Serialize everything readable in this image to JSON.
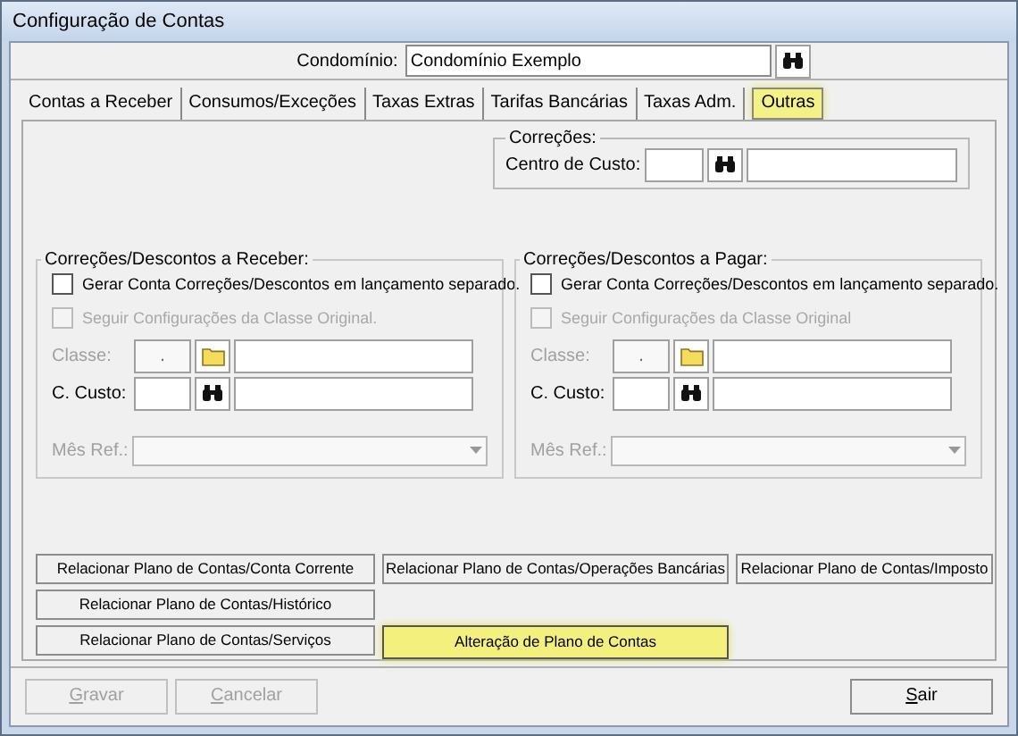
{
  "window": {
    "title": "Configuração de Contas"
  },
  "condominio": {
    "label": "Condomínio:",
    "value": "Condomínio Exemplo"
  },
  "tabs": [
    {
      "label": "Contas a Receber",
      "selected": false
    },
    {
      "label": "Consumos/Exceções",
      "selected": false
    },
    {
      "label": "Taxas Extras",
      "selected": false
    },
    {
      "label": "Tarifas Bancárias",
      "selected": false
    },
    {
      "label": "Taxas Adm.",
      "selected": false
    },
    {
      "label": "Outras",
      "selected": true
    }
  ],
  "correcoes": {
    "title": "Correções:",
    "label": "Centro de Custo:"
  },
  "groups": [
    {
      "title": "Correções/Descontos a Receber:",
      "checkboxes": [
        {
          "label": "Gerar Conta Correções/Descontos em lançamento separado.",
          "checked": false,
          "disabled": false
        },
        {
          "label": "Seguir Configurações da Classe Original.",
          "checked": false,
          "disabled": true
        }
      ],
      "classe": {
        "label": "Classe:",
        "value": ".",
        "disabled": true
      },
      "custo": {
        "label": "C. Custo:",
        "disabled": false
      },
      "mes": {
        "label": "Mês Ref.:",
        "disabled": true
      }
    },
    {
      "title": "Correções/Descontos a Pagar:",
      "checkboxes": [
        {
          "label": "Gerar Conta Correções/Descontos em lançamento separado.",
          "checked": false,
          "disabled": false
        },
        {
          "label": "Seguir Configurações da Classe Original",
          "checked": false,
          "disabled": true
        }
      ],
      "classe": {
        "label": "Classe:",
        "value": ".",
        "disabled": true
      },
      "custo": {
        "label": "C. Custo:",
        "disabled": false
      },
      "mes": {
        "label": "Mês Ref.:",
        "disabled": true
      }
    }
  ],
  "link_buttons": [
    {
      "label": "Relacionar Plano de Contas/Conta Corrente",
      "highlighted": false
    },
    {
      "label": "Relacionar Plano de Contas/Operações Bancárias",
      "highlighted": false
    },
    {
      "label": "Relacionar Plano de Contas/Imposto",
      "highlighted": false
    },
    {
      "label": "Relacionar Plano de Contas/Histórico",
      "highlighted": false
    },
    {
      "label": "Relacionar Plano de Contas/Serviços",
      "highlighted": false
    },
    {
      "label": "Alteração de Plano de Contas",
      "highlighted": true
    }
  ],
  "footer_buttons": [
    {
      "label": "Gravar",
      "disabled": true,
      "kind": "left"
    },
    {
      "label": "Cancelar",
      "disabled": true,
      "kind": "left"
    },
    {
      "label": "Sair",
      "disabled": false,
      "kind": "right"
    }
  ]
}
